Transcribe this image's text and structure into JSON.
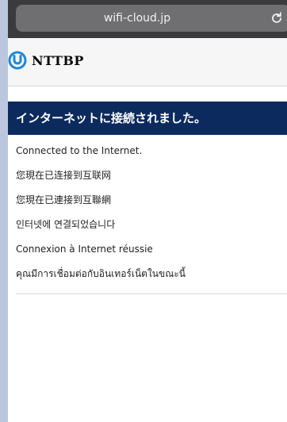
{
  "browser": {
    "url": "wifi-cloud.jp",
    "reload_icon": "reload-icon"
  },
  "header": {
    "logo_text": "NTTBP",
    "logo_icon": "nttbp-logo-mark"
  },
  "banner": {
    "title": "インターネットに接続されました。",
    "color": "#0c2a5e"
  },
  "messages": [
    "Connected to the Internet.",
    "您現在已连接到互联网",
    "您現在已連接到互聯網",
    "인터넷에 연결되었습니다",
    "Connexion à Internet réussie",
    "คุณมีการเชื่อมต่อกับอินเทอร์เน็ตในขณะนี้"
  ]
}
